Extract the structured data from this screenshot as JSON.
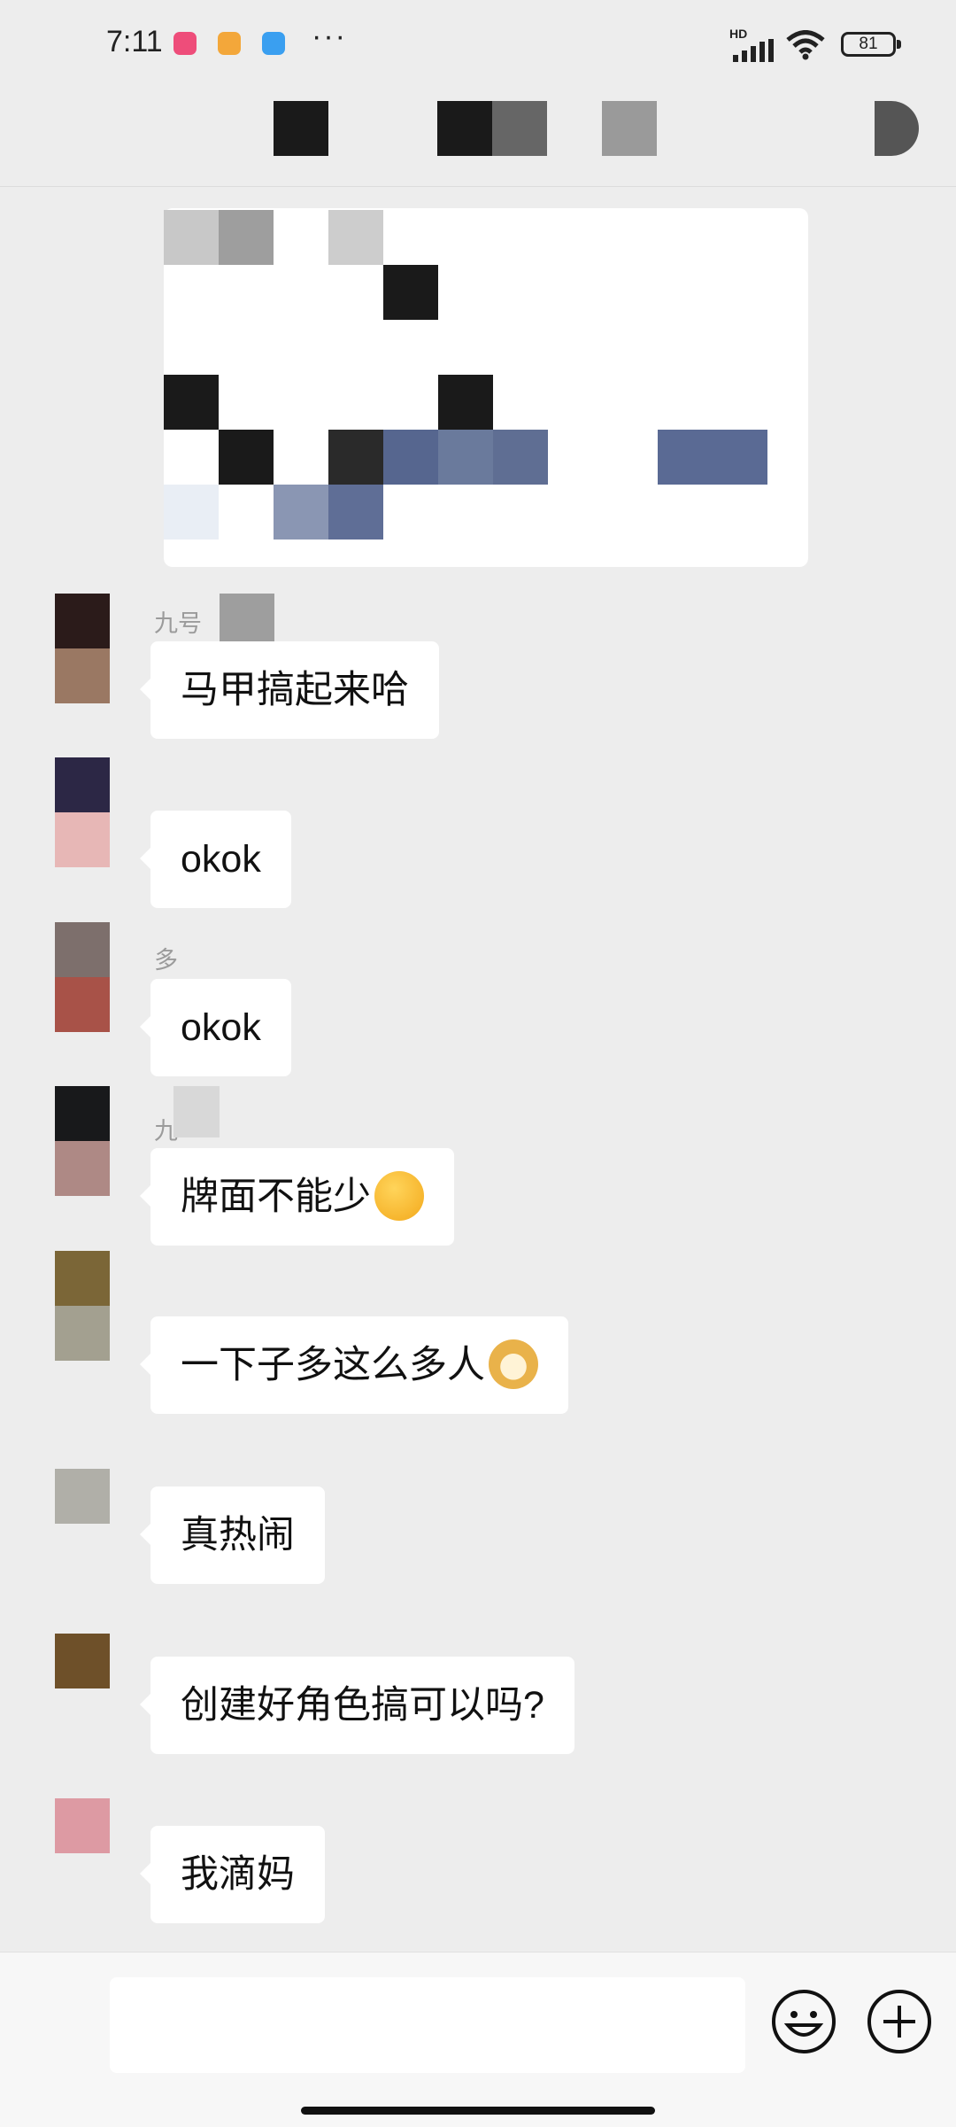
{
  "status_bar": {
    "time": "7:11",
    "more": "···",
    "network": "HD",
    "battery": "81"
  },
  "messages": [
    {
      "sender": "九号",
      "text": "马甲搞起来哈",
      "avatar_colors": [
        "#2b1b1a",
        "#9a7863"
      ]
    },
    {
      "sender": "",
      "text": "okok",
      "avatar_colors": [
        "#2c2745",
        "#e7b7b6"
      ]
    },
    {
      "sender": "多",
      "text": "okok",
      "avatar_colors": [
        "#7d6f6c",
        "#a85248"
      ]
    },
    {
      "sender": "九",
      "text": "牌面不能少",
      "emoji": "thinking-emoji",
      "avatar_colors": [
        "#18191b",
        "#ae8985"
      ]
    },
    {
      "sender": "",
      "text": "一下子多这么多人",
      "emoji": "doge-emoji",
      "avatar_colors": [
        "#7b6637",
        "#a3a090"
      ]
    },
    {
      "sender": "",
      "text": "真热闹",
      "avatar_colors": [
        "#b0afa8"
      ]
    },
    {
      "sender": "",
      "text": "创建好角色搞可以吗?",
      "avatar_colors": [
        "#6e5029"
      ]
    },
    {
      "sender": "",
      "text": "我滴妈",
      "avatar_colors": [
        "#dd9aa3"
      ]
    }
  ],
  "input": {
    "placeholder": "",
    "emoji_button": "smile-icon",
    "plus_button": "plus-icon"
  },
  "colors": {
    "background": "#ededed",
    "bubble": "#ffffff",
    "input_bar": "#f7f7f7",
    "redaction_blue": "#5a6a94"
  }
}
